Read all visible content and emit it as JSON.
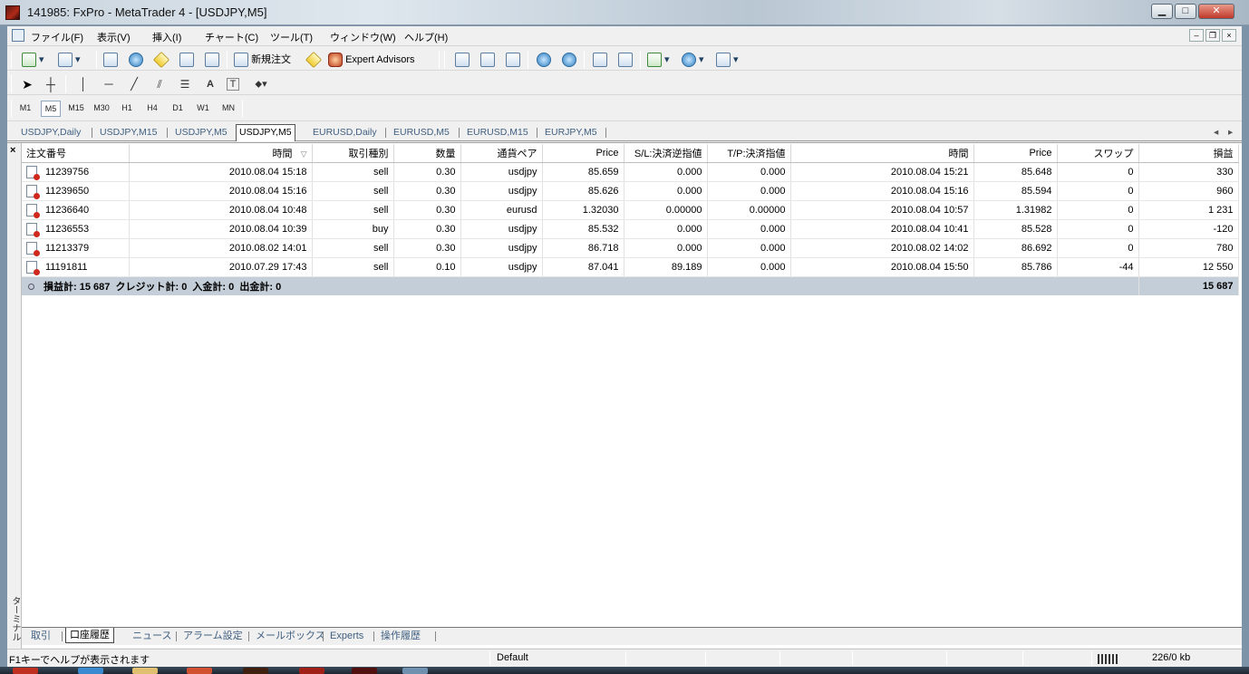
{
  "window": {
    "title": "141985: FxPro - MetaTrader 4 - [USDJPY,M5]",
    "minimize": "▁",
    "maximize": "□",
    "close": "✕"
  },
  "menu": [
    "ファイル(F)",
    "表示(V)",
    "挿入(I)",
    "チャート(C)",
    "ツール(T)",
    "ウィンドウ(W)",
    "ヘルプ(H)"
  ],
  "toolbar": {
    "new_order": "新規注文",
    "expert_advisors": "Expert Advisors"
  },
  "drawing_tools": {
    "text_tool": "A",
    "label_tool": "T"
  },
  "timeframes": [
    "M1",
    "M5",
    "M15",
    "M30",
    "H1",
    "H4",
    "D1",
    "W1",
    "MN"
  ],
  "active_timeframe": "M5",
  "chart_tabs": [
    "USDJPY,Daily",
    "USDJPY,M15",
    "USDJPY,M5",
    "USDJPY,M5",
    "EURUSD,Daily",
    "EURUSD,M5",
    "EURUSD,M15",
    "EURJPY,M5"
  ],
  "active_chart_tab": 3,
  "tab_scroll": {
    "left": "◂",
    "right": "▸"
  },
  "terminal": {
    "close": "×",
    "side_label": "ターミナル",
    "columns": [
      "注文番号",
      "時間",
      "取引種別",
      "数量",
      "通貨ペア",
      "Price",
      "S/L:決済逆指値",
      "T/P:決済指値",
      "時間",
      "Price",
      "スワップ",
      "損益"
    ],
    "sort_indicator": "▽",
    "rows": [
      [
        "11239756",
        "2010.08.04 15:18",
        "sell",
        "0.30",
        "usdjpy",
        "85.659",
        "0.000",
        "0.000",
        "2010.08.04 15:21",
        "85.648",
        "0",
        "330"
      ],
      [
        "11239650",
        "2010.08.04 15:16",
        "sell",
        "0.30",
        "usdjpy",
        "85.626",
        "0.000",
        "0.000",
        "2010.08.04 15:16",
        "85.594",
        "0",
        "960"
      ],
      [
        "11236640",
        "2010.08.04 10:48",
        "sell",
        "0.30",
        "eurusd",
        "1.32030",
        "0.00000",
        "0.00000",
        "2010.08.04 10:57",
        "1.31982",
        "0",
        "1 231"
      ],
      [
        "11236553",
        "2010.08.04 10:39",
        "buy",
        "0.30",
        "usdjpy",
        "85.532",
        "0.000",
        "0.000",
        "2010.08.04 10:41",
        "85.528",
        "0",
        "-120"
      ],
      [
        "11213379",
        "2010.08.02 14:01",
        "sell",
        "0.30",
        "usdjpy",
        "86.718",
        "0.000",
        "0.000",
        "2010.08.02 14:02",
        "86.692",
        "0",
        "780"
      ],
      [
        "11191811",
        "2010.07.29 17:43",
        "sell",
        "0.10",
        "usdjpy",
        "87.041",
        "89.189",
        "0.000",
        "2010.08.04 15:50",
        "85.786",
        "-44",
        "12 550"
      ]
    ],
    "summary_text": "損益計: 15 687  クレジット計: 0  入金計: 0  出金計: 0",
    "summary_total": "15 687",
    "tabs": [
      "取引",
      "口座履歴",
      "ニュース",
      "アラーム設定",
      "メールボックス",
      "Experts",
      "操作履歴"
    ],
    "active_tab": 1
  },
  "status": {
    "help": "F1キーでヘルプが表示されます",
    "profile": "Default",
    "traffic": "226/0 kb"
  },
  "colors": {
    "summary_row": "#c4ced8",
    "loss_marker": "#d0281c",
    "tab_text": "#3f5f80"
  }
}
